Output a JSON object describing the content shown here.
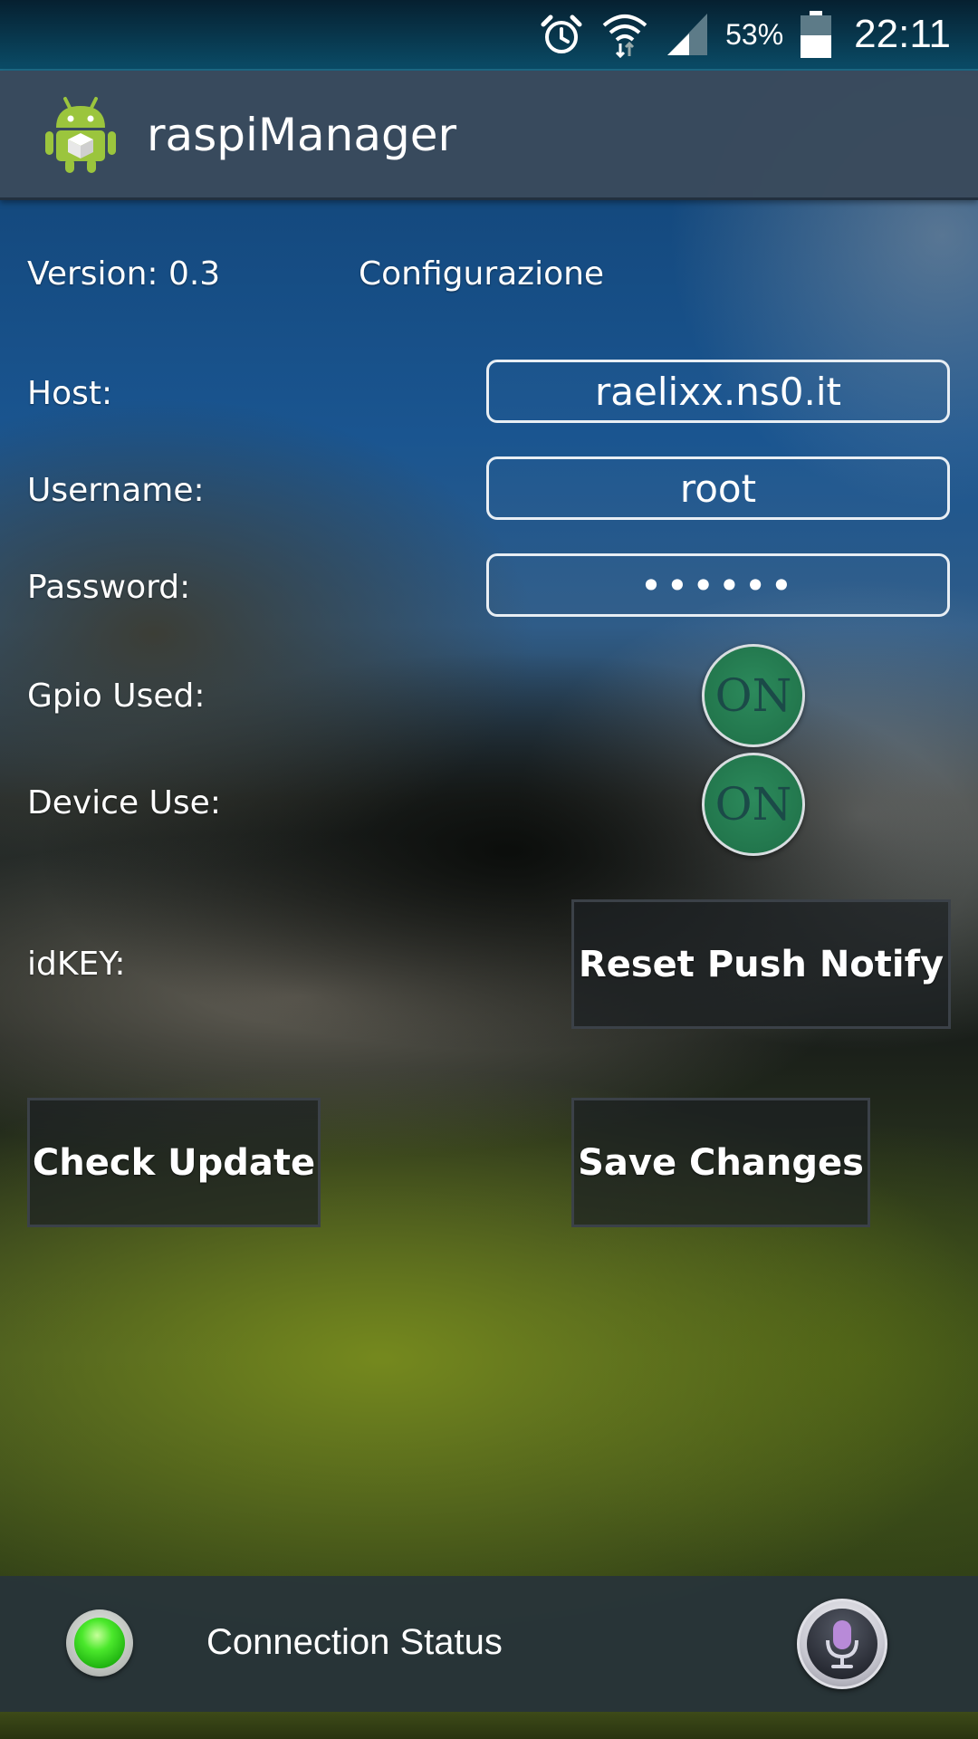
{
  "status_bar": {
    "battery_percent": "53%",
    "time": "22:11",
    "icons": [
      "alarm-icon",
      "wifi-icon",
      "signal-icon",
      "battery-icon"
    ]
  },
  "action_bar": {
    "title": "raspiManager",
    "icon": "android-app-icon"
  },
  "header": {
    "version": "Version: 0.3",
    "section": "Configurazione"
  },
  "form": {
    "host_label": "Host:",
    "host_value": "raelixx.ns0.it",
    "username_label": "Username:",
    "username_value": "root",
    "password_label": "Password:",
    "password_value": "••••••",
    "gpio_label": "Gpio Used:",
    "gpio_toggle": "ON",
    "device_label": "Device Use:",
    "device_toggle": "ON",
    "idkey_label": "idKEY:"
  },
  "buttons": {
    "reset_push": "Reset Push Notify",
    "check_update": "Check Update",
    "save_changes": "Save Changes"
  },
  "bottom_bar": {
    "connection_status": "Connection Status",
    "led_color": "#2ecc1a"
  },
  "colors": {
    "action_bar": "#3a4a5c",
    "toggle_on": "#2c8a5c"
  }
}
